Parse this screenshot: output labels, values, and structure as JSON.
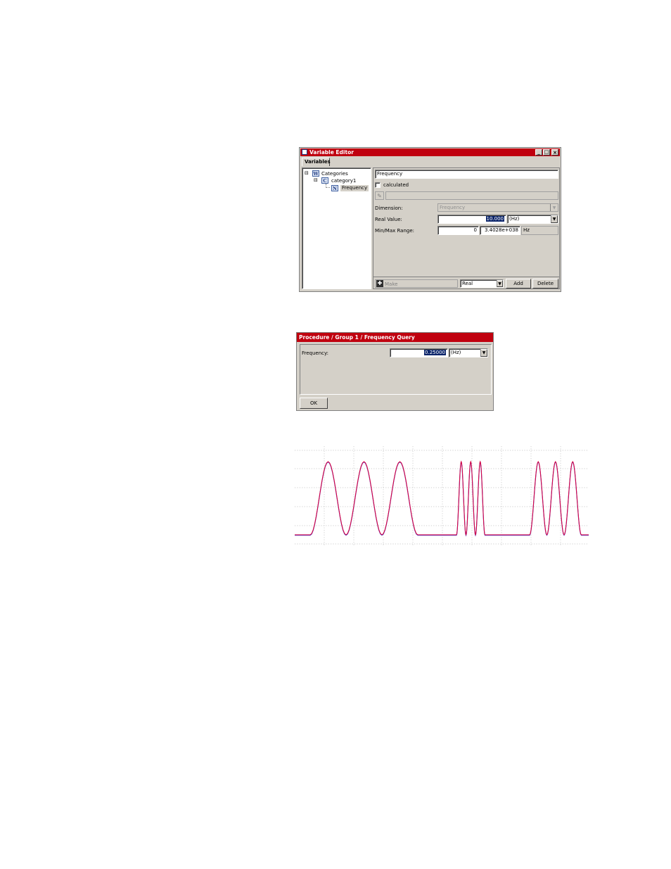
{
  "variable_editor": {
    "title": "Variable Editor",
    "tab": "Variables",
    "tree": {
      "root": "Categories",
      "category": "category1",
      "variable": "Frequency"
    },
    "name_value": "Frequency",
    "calculated_label": "calculated",
    "dimension_label": "Dimension:",
    "dimension_value": "Frequency",
    "real_value_label": "Real Value:",
    "real_value": "10.000",
    "real_value_unit": "(Hz)",
    "minmax_label": "Min/Max Range:",
    "min_value": "0",
    "max_value": "3.4028e+038",
    "range_unit": "Hz",
    "make_label": "Make",
    "type_value": "Real",
    "add_label": "Add",
    "delete_label": "Delete"
  },
  "frequency_query": {
    "title": "Procedure / Group 1 / Frequency Query",
    "frequency_label": "Frequency:",
    "frequency_value": "0.25000",
    "unit": "(Hz)",
    "ok_label": "OK"
  },
  "colors": {
    "titlebar": "#c0000f",
    "signal_red": "#e0003a",
    "signal_blue": "#4a3cd0"
  }
}
